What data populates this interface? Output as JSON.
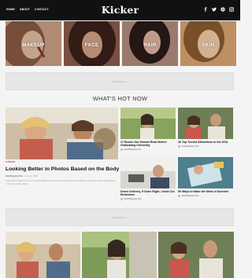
{
  "header": {
    "logo": "Kicker",
    "nav": [
      "HOME",
      "ABOUT",
      "CONTACT"
    ],
    "social_icons": [
      "facebook-icon",
      "twitter-icon",
      "pinterest-icon",
      "instagram-icon"
    ]
  },
  "categories": [
    {
      "label": "MAKEUP"
    },
    {
      "label": "FACE"
    },
    {
      "label": "HAIR"
    },
    {
      "label": "SKIN"
    }
  ],
  "ad": {
    "label": "Advertisement"
  },
  "section_title": "WHAT'S HOT NOW",
  "featured": {
    "category": "FITNESS",
    "title": "Looking Better in Photos Based on the Body Type",
    "author": "SoraShopping Two",
    "date": "June 22, 2018",
    "excerpt": "Lorem ipsum dolor sit amet consectetur adipiscing elit sed do eiusmod tempor incididunt ut labore et dolore magna aliqua ut enim ad minim veniam"
  },
  "cards": [
    {
      "title": "17 Books You Should Read Before Graduating University",
      "author": "SoraShopping Two"
    },
    {
      "title": "26 Top Tourist Attractions in the USA",
      "author": "SoraShopping Two"
    },
    {
      "title": "Drone Delivery, If Done Right, Could Cut Emissions",
      "author": "SoraShopping Two"
    },
    {
      "title": "50 Ways to Make the Most of Summer",
      "author": "SoraShopping Two"
    }
  ]
}
